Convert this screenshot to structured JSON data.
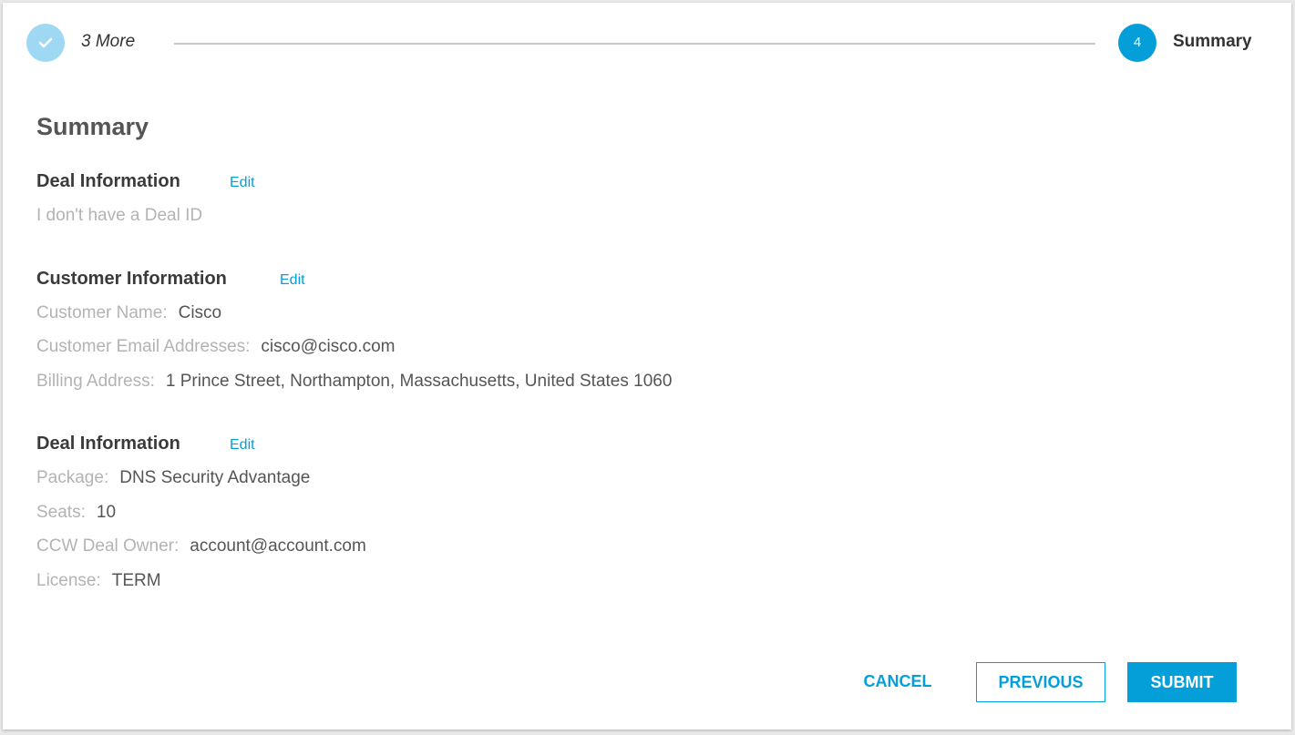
{
  "stepper": {
    "done_label": "3 More",
    "current_number": "4",
    "current_label": "Summary"
  },
  "title": "Summary",
  "sections": [
    {
      "heading": "Deal Information",
      "edit": "Edit",
      "text": "I don't have a Deal ID"
    },
    {
      "heading": "Customer Information",
      "edit": "Edit",
      "fields": [
        {
          "label": "Customer Name:",
          "value": "Cisco"
        },
        {
          "label": "Customer Email Addresses:",
          "value": "cisco@cisco.com"
        },
        {
          "label": "Billing Address:",
          "value": "1 Prince Street, Northampton, Massachusetts, United States 1060"
        }
      ]
    },
    {
      "heading": "Deal Information",
      "edit": "Edit",
      "fields": [
        {
          "label": "Package:",
          "value": "DNS Security Advantage"
        },
        {
          "label": "Seats:",
          "value": "10"
        },
        {
          "label": "CCW Deal Owner:",
          "value": "account@account.com"
        },
        {
          "label": "License:",
          "value": "TERM"
        }
      ]
    }
  ],
  "buttons": {
    "cancel": "CANCEL",
    "previous": "PREVIOUS",
    "submit": "SUBMIT"
  },
  "colors": {
    "accent": "#049fd9",
    "step_done": "#9ed8f3"
  },
  "icons": {
    "step_done": "check-icon"
  }
}
